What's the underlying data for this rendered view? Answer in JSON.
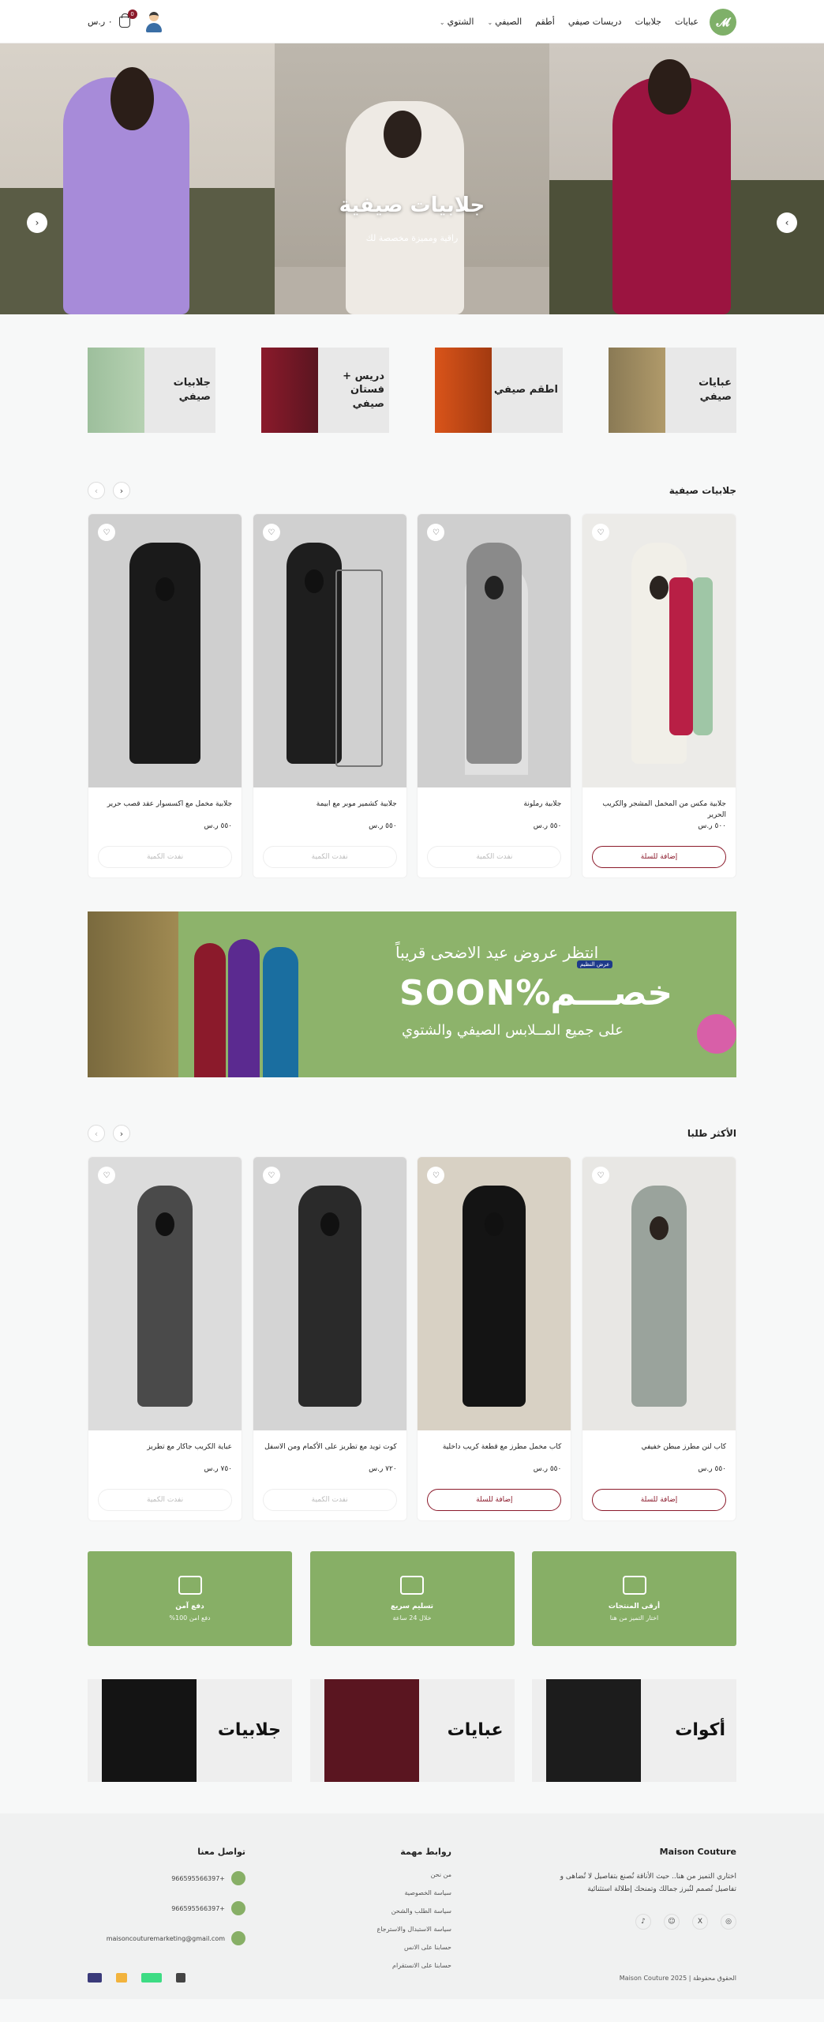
{
  "header": {
    "nav": [
      {
        "label": "عبايات",
        "chevron": false
      },
      {
        "label": "جلابيات",
        "chevron": false
      },
      {
        "label": "دريسات صيفي",
        "chevron": false
      },
      {
        "label": "أطقم",
        "chevron": false
      },
      {
        "label": "الصيفي",
        "chevron": true
      },
      {
        "label": "الشتوي",
        "chevron": true
      }
    ],
    "cart_total": "٠ ر.س",
    "cart_count": "0"
  },
  "hero": {
    "title": "جلابيات صيفية",
    "subtitle": "راقية ومميزة مخصصة لك"
  },
  "categories": [
    {
      "label": "عبايات صيفي"
    },
    {
      "label": "اطقم صيفي"
    },
    {
      "label": "دريس + فستان صيفي"
    },
    {
      "label": "جلابيات صيفي"
    }
  ],
  "section1": {
    "title": "جلابيات صيفية",
    "products": [
      {
        "name": "جلابية مكس من المخمل المشجر والكريب الحرير",
        "price": "٥٠٠ ر.س",
        "button": "إضافة للسلة",
        "in_stock": true
      },
      {
        "name": "جلابية رملونة",
        "price": "٥٥٠ ر.س",
        "button": "نفدت الكمية",
        "in_stock": false
      },
      {
        "name": "جلابية كشمير موبر مع ابيمة",
        "price": "٥٥٠ ر.س",
        "button": "نفدت الكمية",
        "in_stock": false
      },
      {
        "name": "جلابية مخمل مع اكسسوار عقد قصب حرير",
        "price": "٥٥٠ ر.س",
        "button": "نفدت الكمية",
        "in_stock": false
      }
    ]
  },
  "banner": {
    "line1": "انتظر عروض عيد الاضحى قريباً",
    "big": "خصـــم%SOON",
    "line3": "على جميع المــلابس الصيفي والشتوي",
    "tag": "عرض النظيم"
  },
  "section2": {
    "title": "الأكثر طلبا",
    "products": [
      {
        "name": "كاب لنن مطرز مبطن خفيفي",
        "price": "٥٥٠ ر.س",
        "button": "إضافة للسلة",
        "in_stock": true
      },
      {
        "name": "كاب مخمل مطرز مع قطعة كريب داخلية",
        "price": "٥٥٠ ر.س",
        "button": "إضافة للسلة",
        "in_stock": true
      },
      {
        "name": "كوت تويد مع تطريز على الأكمام ومن الاسفل",
        "price": "٧٢٠ ر.س",
        "button": "نفدت الكمية",
        "in_stock": false
      },
      {
        "name": "عباية الكريب جاكار مع تطريز",
        "price": "٧٥٠ ر.س",
        "button": "نفدت الكمية",
        "in_stock": false
      }
    ]
  },
  "features": [
    {
      "title": "أرقى المنتجات",
      "sub": "اختار التميز من هنا",
      "icon": "store-icon"
    },
    {
      "title": "تسليم سريع",
      "sub": "خلال 24 ساعة",
      "icon": "truck-icon"
    },
    {
      "title": "دفع آمن",
      "sub": "دفع امن 100%",
      "icon": "card-icon"
    }
  ],
  "promos": [
    {
      "label": "أكوات"
    },
    {
      "label": "عبايات"
    },
    {
      "label": "جلابيات"
    }
  ],
  "footer": {
    "brand": "Maison Couture",
    "about": "اختاري التميز من هنا.. حيث الأناقة تُصنع بتفاصيل لا تُضاهى و تفاصيل تُصمم لتُبرز جمالك وتمنحك إطلالة استثنائية",
    "links_title": "روابط مهمة",
    "links": [
      "من نحن",
      "سياسة الخصوصية",
      "سياسة الطلب والشحن",
      "سياسة الاستبدال والاسترجاع",
      "حسابنا على الانس",
      "حسابنا على الانستقرام"
    ],
    "contact_title": "تواصل معنا",
    "contacts": [
      "+966595566397",
      "+966595566397",
      "maisoncouturemarketing@gmail.com"
    ],
    "copyright": "الحقوق محفوظة | Maison Couture 2025"
  }
}
